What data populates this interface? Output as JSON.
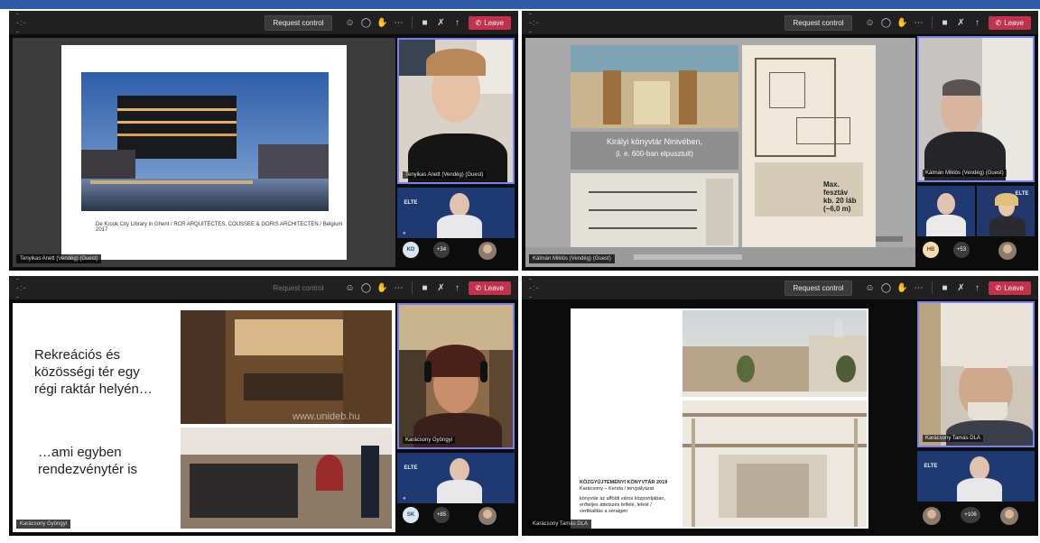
{
  "meeting": {
    "q1": {
      "timer": "--:--",
      "request_control": "Request control",
      "leave": "Leave",
      "presenter_name": "Tenyikas Anett (Vendég) (Guest)",
      "slide_caption": "De Krook City Library in Ghent / RCR ARQUITECTES, COUSSEE & GORIS ARCHITECTEN / Belgium 2017",
      "speaker_tile_name": "Tenyikas Anett (Vendég) (Guest)",
      "avatar_initials": "KD",
      "overflow_count": "+34",
      "elte_label": "ELTE"
    },
    "q2": {
      "timer": "--:--",
      "request_control": "Request control",
      "leave": "Leave",
      "presenter_name": "Kálmán Miklós (Vendég) (Guest)",
      "slide_caption_line1": "Királyi könyvtár Ninivében,",
      "slide_caption_line2": "(i. e. 600-ban elpusztult)",
      "slide_max_line1": "Max.",
      "slide_max_line2": "fesztáv",
      "slide_max_line3": "kb. 20 láb",
      "slide_max_line4": "(~6,0 m)",
      "speaker_tile_name": "Kálmán Miklós (Vendég) (Guest)",
      "avatar_initials": "HB",
      "overflow_count": "+53",
      "elte_label": "ELTE"
    },
    "q3": {
      "timer": "--:--",
      "request_control": "Request control",
      "leave": "Leave",
      "presenter_name": "Karácsony Gyöngyi",
      "slide_text_1a": "Rekreációs és",
      "slide_text_1b": "közösségi tér egy",
      "slide_text_1c": "régi raktár helyén…",
      "slide_text_2a": "…ami egyben",
      "slide_text_2b": "rendezvénytér is",
      "watermark": "www.unideb.hu",
      "speaker_tile_name": "Karácsony Gyöngyi",
      "avatar_initials": "SK",
      "overflow_count": "+85",
      "elte_label": "ELTE"
    },
    "q4": {
      "timer": "--:--",
      "request_control": "Request control",
      "leave": "Leave",
      "presenter_name": "Karácsony Tamás DLA",
      "slide_heading": "KÖZGYŰJTEMÉNYI KÖNYVTÁR    2019",
      "slide_line1": "Karácsony – Kenda / tervpályázat",
      "slide_line2": "könyvtár az afföldi város központjában,",
      "slide_line3": "erőteljes áttetszés felfelé, lefelé /",
      "slide_line4": "vertikalitás a séraigen",
      "speaker_tile_name": "Karácsony Tamás DLA",
      "overflow_count": "+106",
      "elte_label": "ELTE"
    }
  },
  "colors": {
    "leave": "#c4314b",
    "active_border": "#7b83eb",
    "topbar": "#2b5ca8"
  }
}
